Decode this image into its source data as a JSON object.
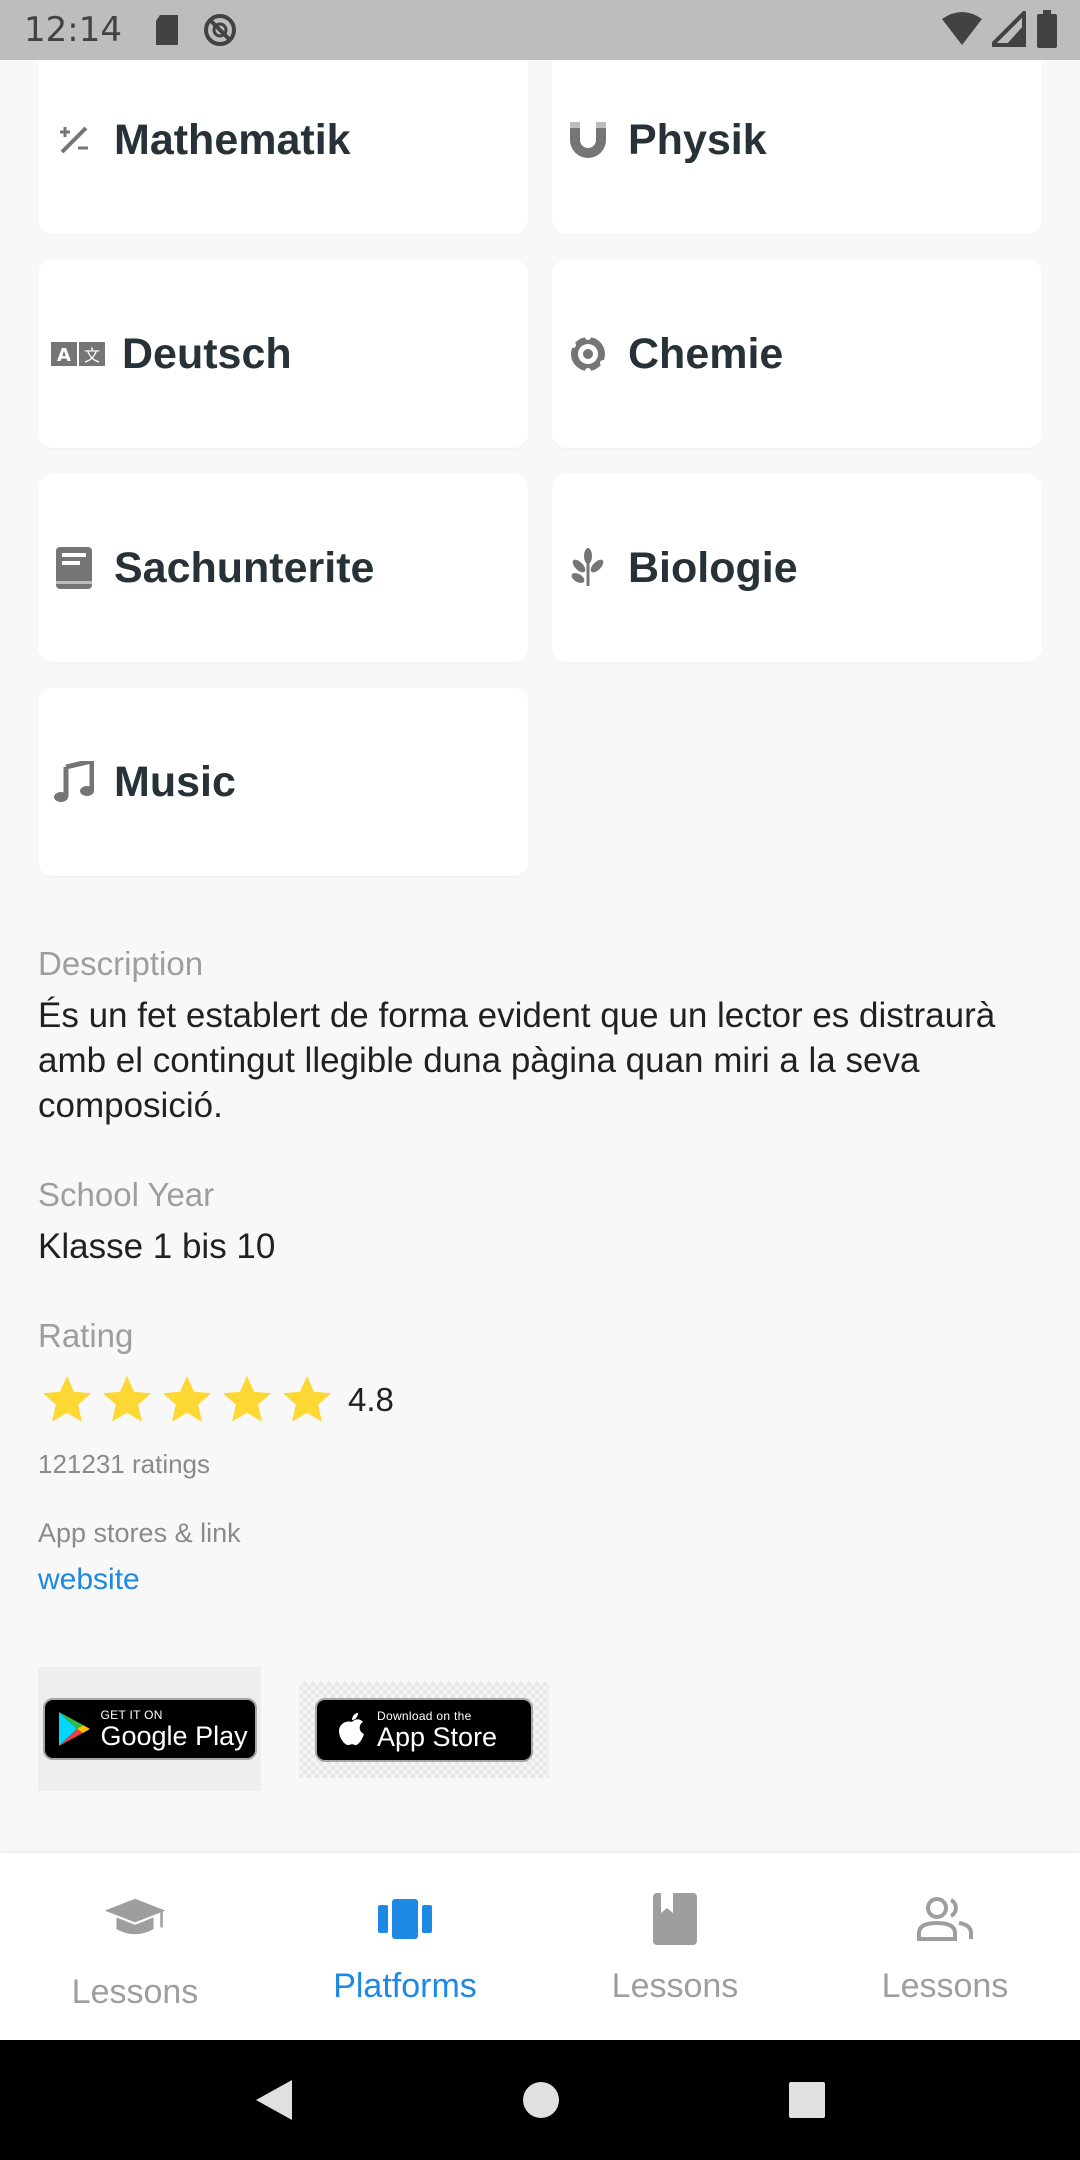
{
  "status_bar": {
    "time": "12:14"
  },
  "subjects": [
    {
      "label": "Mathematik",
      "icon": "math-icon"
    },
    {
      "label": "Physik",
      "icon": "magnet-icon"
    },
    {
      "label": "Deutsch",
      "icon": "translate-icon"
    },
    {
      "label": "Chemie",
      "icon": "atom-icon"
    },
    {
      "label": "Sachunterite",
      "icon": "book-icon"
    },
    {
      "label": "Biologie",
      "icon": "plant-icon"
    },
    {
      "label": "Music",
      "icon": "music-note-icon"
    }
  ],
  "description": {
    "label": "Description",
    "text": "És un fet establert de forma evident que un lector es distraurà amb el contingut llegible duna pàgina quan miri a la seva composició."
  },
  "school_year": {
    "label": "School Year",
    "value": "Klasse 1 bis 10"
  },
  "rating": {
    "label": "Rating",
    "value": "4.8",
    "stars": 5,
    "count": "121231 ratings",
    "star_color": "#fdd835"
  },
  "links": {
    "label": "App stores & link",
    "website": "website"
  },
  "stores": {
    "google_small": "GET IT ON",
    "google_big": "Google Play",
    "apple_small": "Download on the",
    "apple_big": "App Store"
  },
  "bottom_nav": {
    "items": [
      {
        "label": "Lessons",
        "icon": "graduation-cap-icon",
        "active": false
      },
      {
        "label": "Platforms",
        "icon": "carousel-icon",
        "active": true
      },
      {
        "label": "Lessons",
        "icon": "bookmark-book-icon",
        "active": false
      },
      {
        "label": "Lessons",
        "icon": "people-icon",
        "active": false
      }
    ],
    "active_color": "#1e88e5",
    "inactive_color": "#9e9e9e"
  }
}
